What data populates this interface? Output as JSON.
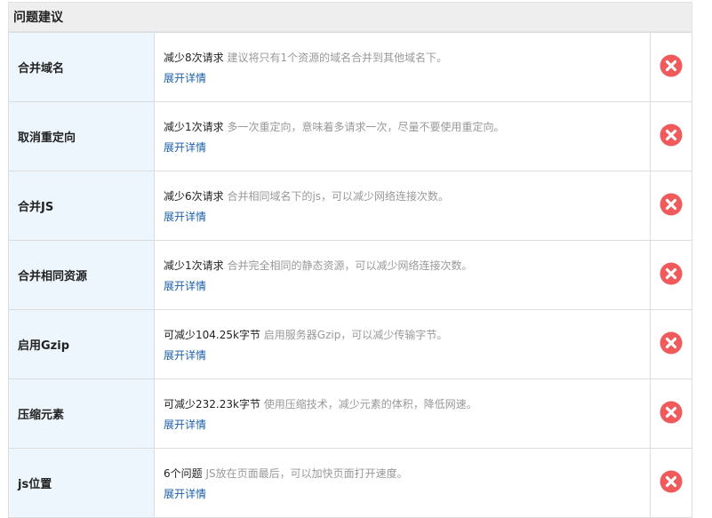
{
  "section_title": "问题建议",
  "icon_color": "#f05a5a",
  "rows": [
    {
      "name": "合并域名",
      "strong": "减少8次请求",
      "text": "建议将只有1个资源的域名合并到其他域名下。",
      "link": "展开详情",
      "icon": "close-icon"
    },
    {
      "name": "取消重定向",
      "strong": "减少1次请求",
      "text": "多一次重定向，意味着多请求一次，尽量不要使用重定向。",
      "link": "展开详情",
      "icon": "close-icon"
    },
    {
      "name": "合并JS",
      "strong": "减少6次请求",
      "text": "合并相同域名下的js，可以减少网络连接次数。",
      "link": "展开详情",
      "icon": "close-icon"
    },
    {
      "name": "合并相同资源",
      "strong": "减少1次请求",
      "text": "合并完全相同的静态资源，可以减少网络连接次数。",
      "link": "展开详情",
      "icon": "close-icon"
    },
    {
      "name": "启用Gzip",
      "strong": "可减少104.25k字节",
      "text": "启用服务器Gzip，可以减少传输字节。",
      "link": "展开详情",
      "icon": "close-icon"
    },
    {
      "name": "压缩元素",
      "strong": "可减少232.23k字节",
      "text": "使用压缩技术，减少元素的体积，降低网速。",
      "link": "展开详情",
      "icon": "close-icon"
    },
    {
      "name": "js位置",
      "strong": "6个问题",
      "text": "JS放在页面最后，可以加快页面打开速度。",
      "link": "展开详情",
      "icon": "close-icon"
    }
  ]
}
